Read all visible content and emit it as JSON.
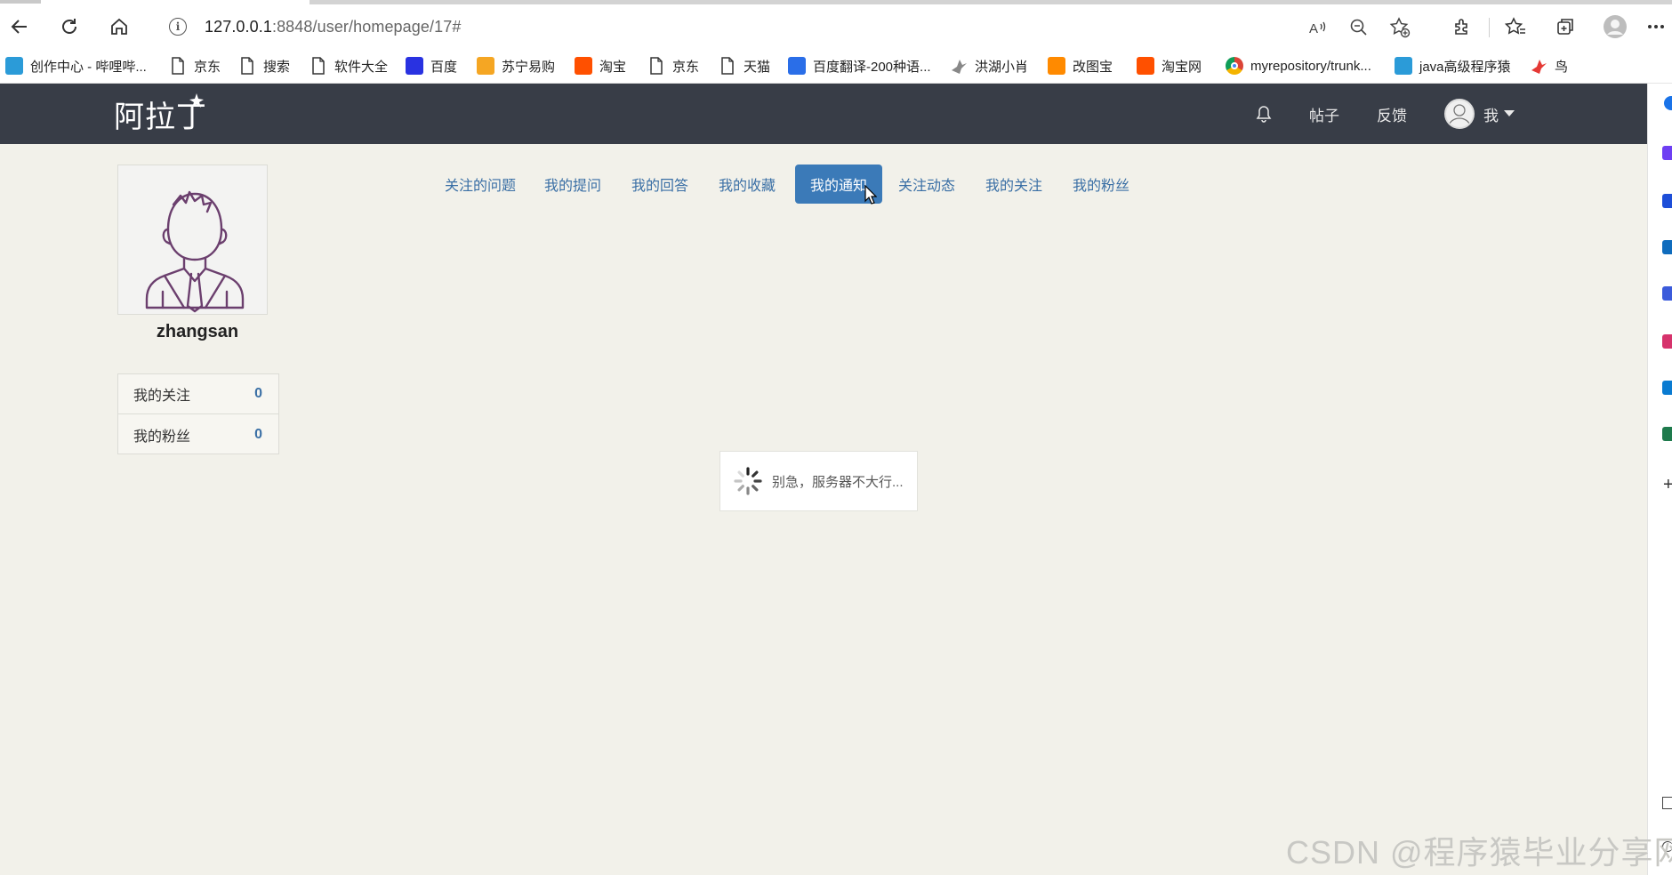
{
  "browser": {
    "url_host": "127.0.0.1",
    "url_rest": ":8848/user/homepage/17#",
    "bookmarks": [
      {
        "label": "创作中心 - 哔哩哔...",
        "icon": "bilibili-icon",
        "color": "#2b9bd8"
      },
      {
        "label": "京东",
        "icon": "page-icon",
        "color": ""
      },
      {
        "label": "搜索",
        "icon": "page-icon",
        "color": ""
      },
      {
        "label": "软件大全",
        "icon": "page-icon",
        "color": ""
      },
      {
        "label": "百度",
        "icon": "baidu-paw-icon",
        "color": "#2932e1"
      },
      {
        "label": "苏宁易购",
        "icon": "suning-icon",
        "color": "#f5a623"
      },
      {
        "label": "淘宝",
        "icon": "taobao-icon",
        "color": "#ff5000"
      },
      {
        "label": "京东",
        "icon": "page-icon",
        "color": ""
      },
      {
        "label": "天猫",
        "icon": "page-icon",
        "color": ""
      },
      {
        "label": "百度翻译-200种语...",
        "icon": "translate-icon",
        "color": "#2a6ee8"
      },
      {
        "label": "洪湖小肖",
        "icon": "bird-icon",
        "color": "#888888"
      },
      {
        "label": "改图宝",
        "icon": "gaitubao-icon",
        "color": "#ff8a00"
      },
      {
        "label": "淘宝网",
        "icon": "taobao-icon",
        "color": "#ff5000"
      },
      {
        "label": "myrepository/trunk...",
        "icon": "chrome-icon",
        "color": "#db4437"
      },
      {
        "label": "java高级程序猿",
        "icon": "bilibili-icon",
        "color": "#2b9bd8"
      },
      {
        "label": "鸟",
        "icon": "bird-red-icon",
        "color": "#e53935"
      }
    ]
  },
  "site": {
    "logo": "阿拉丁",
    "nav": {
      "posts": "帖子",
      "feedback": "反馈",
      "me": "我"
    }
  },
  "profile": {
    "username": "zhangsan",
    "stats": [
      {
        "label": "我的关注",
        "value": "0"
      },
      {
        "label": "我的粉丝",
        "value": "0"
      }
    ]
  },
  "tabs": [
    {
      "label": "关注的问题",
      "active": false
    },
    {
      "label": "我的提问",
      "active": false
    },
    {
      "label": "我的回答",
      "active": false
    },
    {
      "label": "我的收藏",
      "active": false
    },
    {
      "label": "我的通知",
      "active": true
    },
    {
      "label": "关注动态",
      "active": false
    },
    {
      "label": "我的关注",
      "active": false
    },
    {
      "label": "我的粉丝",
      "active": false
    }
  ],
  "loading": {
    "text": "别急，服务器不大行..."
  },
  "watermark": "CSDN @程序猿毕业分享网",
  "colors": {
    "navbar": "#383d47",
    "accent": "#3b7ab8",
    "link": "#3a6fa5",
    "page_bg": "#f2f1ea"
  }
}
